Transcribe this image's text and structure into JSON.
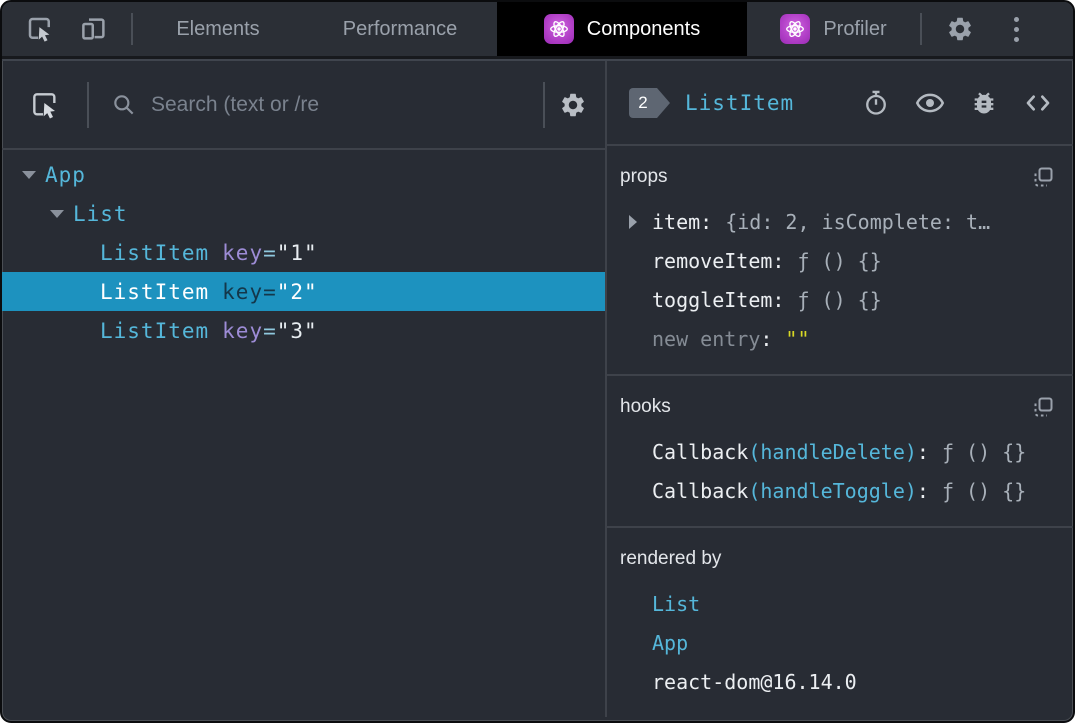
{
  "tabbar": {
    "tabs": [
      {
        "label": "Elements"
      },
      {
        "label": "Performance"
      },
      {
        "label": "Components"
      },
      {
        "label": "Profiler"
      }
    ]
  },
  "toolbar": {
    "search_placeholder": "Search (text or /re"
  },
  "tree": {
    "rows": [
      {
        "name": "App"
      },
      {
        "name": "List"
      },
      {
        "name": "ListItem",
        "attr": "key",
        "eq": "=",
        "value": "\"1\""
      },
      {
        "name": "ListItem",
        "attr": "key",
        "eq": "=",
        "value": "\"2\""
      },
      {
        "name": "ListItem",
        "attr": "key",
        "eq": "=",
        "value": "\"3\""
      }
    ]
  },
  "inspector": {
    "badge": "2",
    "component": "ListItem",
    "props": {
      "title": "props",
      "rows": [
        {
          "name": "item",
          "colon": ":",
          "value": "{id: 2, isComplete: t…"
        },
        {
          "name": "removeItem",
          "colon": ":",
          "value": "ƒ () {}"
        },
        {
          "name": "toggleItem",
          "colon": ":",
          "value": "ƒ () {}"
        },
        {
          "name": "new entry",
          "colon": ":",
          "value": "\"\""
        }
      ]
    },
    "hooks": {
      "title": "hooks",
      "rows": [
        {
          "name": "Callback",
          "paren": "(handleDelete)",
          "colon": ":",
          "value": "ƒ () {}"
        },
        {
          "name": "Callback",
          "paren": "(handleToggle)",
          "colon": ":",
          "value": "ƒ () {}"
        }
      ]
    },
    "rendered_by": {
      "title": "rendered by",
      "items": [
        "List",
        "App",
        "react-dom@16.14.0"
      ]
    }
  },
  "colors": {
    "panel_background": "#282c34",
    "divider": "#3e424a",
    "selection": "#1d92bf",
    "component_cyan": "#55b7da",
    "key_purple": "#9d8cd6",
    "string_yellow": "#d8d825",
    "react_purple": "#b341c8",
    "active_tab": "#000000"
  }
}
